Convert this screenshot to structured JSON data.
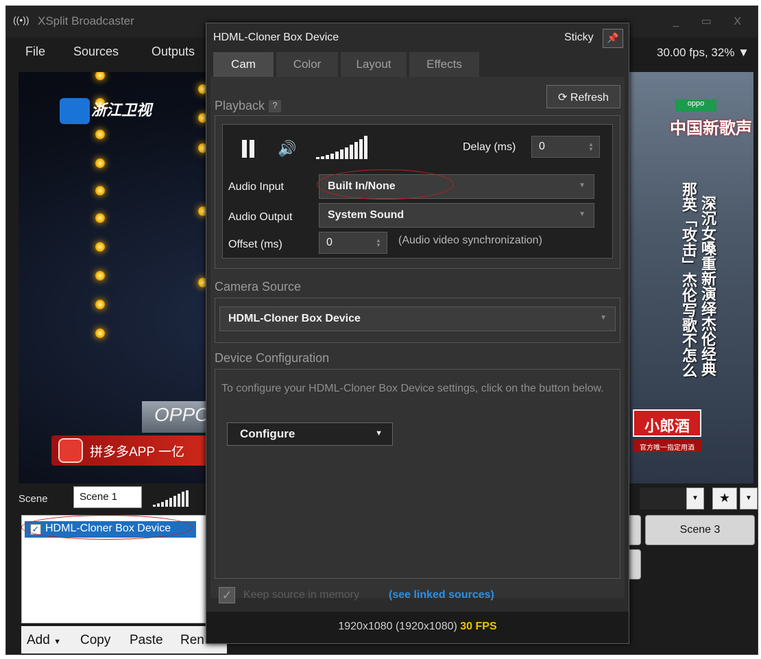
{
  "app": {
    "title": "XSplit Broadcaster",
    "window_controls": "_ ▭ X",
    "fps_info": "30.00 fps, 32%",
    "menu": [
      "File",
      "Sources",
      "Outputs"
    ]
  },
  "preview": {
    "channel_logo_text": "浙江卫视",
    "oppo_text": "OPPO",
    "pdd_banner": "拼多多APP 一亿",
    "oppo_badge": "oppo",
    "show_title": "中国新歌声",
    "vertical_text_1": "那英「攻击」杰伦写歌不怎么",
    "vertical_text_2": "深沉女嗓重新演绎杰伦经典",
    "sponsor": "小郎酒",
    "sponsor_sub": "官方唯一指定用酒"
  },
  "scene": {
    "label": "Scene",
    "current": "Scene 1",
    "buttons": [
      "Scene 3"
    ]
  },
  "sources": {
    "items": [
      {
        "label": "HDML-Cloner Box Device",
        "checked": true
      }
    ],
    "toolbar": [
      "Add",
      "Copy",
      "Paste",
      "Ren"
    ]
  },
  "dialog": {
    "title": "HDML-Cloner Box Device",
    "sticky_label": "Sticky",
    "tabs": [
      "Cam",
      "Color",
      "Layout",
      "Effects"
    ],
    "active_tab": "Cam",
    "playback": {
      "title": "Playback",
      "help": "?",
      "refresh_label": "Refresh",
      "delay_label": "Delay (ms)",
      "delay_value": "0",
      "audio_input_label": "Audio Input",
      "audio_input_value": "Built In/None",
      "audio_output_label": "Audio Output",
      "audio_output_value": "System Sound",
      "offset_label": "Offset (ms)",
      "offset_value": "0",
      "offset_note": "(Audio video synchronization)"
    },
    "camera_source": {
      "title": "Camera Source",
      "value": "HDML-Cloner Box Device"
    },
    "device_config": {
      "title": "Device Configuration",
      "text": "To configure your HDML-Cloner Box Device settings, click on the button below.",
      "button_label": "Configure"
    },
    "keep_source_label": "Keep source in memory",
    "linked_sources_label": "(see linked sources)",
    "status_resolution": "1920x1080 (1920x1080)",
    "status_fps": "30 FPS"
  },
  "colors": {
    "accent_blue": "#1e6fc0",
    "link_blue": "#2d8fe0",
    "fps_yellow": "#f0c000",
    "annotation_red": "#c02020"
  }
}
